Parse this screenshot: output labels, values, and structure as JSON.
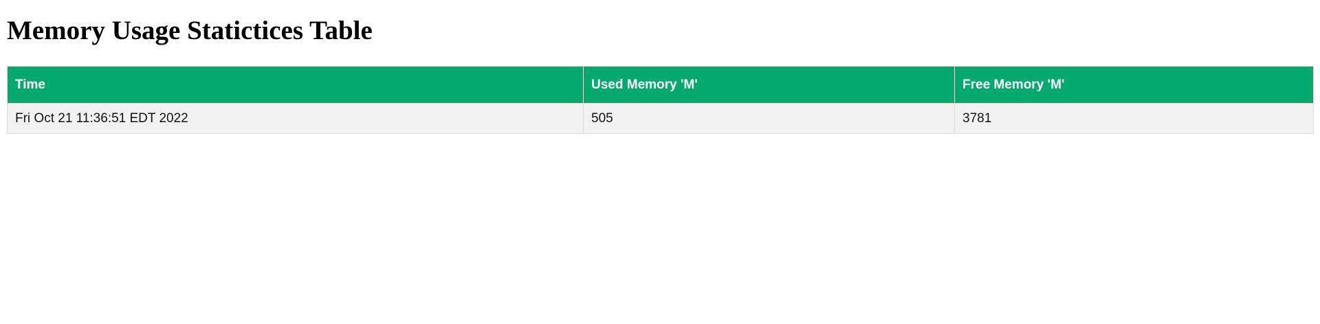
{
  "page": {
    "title": "Memory Usage Statictices Table"
  },
  "colors": {
    "header_bg": "#04AA6D",
    "header_text": "#ffffff",
    "row_bg": "#f2f2f2",
    "border": "#dddddd"
  },
  "table": {
    "columns": [
      "Time",
      "Used Memory 'M'",
      "Free Memory 'M'"
    ],
    "rows": [
      [
        "Fri Oct 21 11:36:51 EDT 2022",
        "505",
        "3781"
      ]
    ]
  }
}
